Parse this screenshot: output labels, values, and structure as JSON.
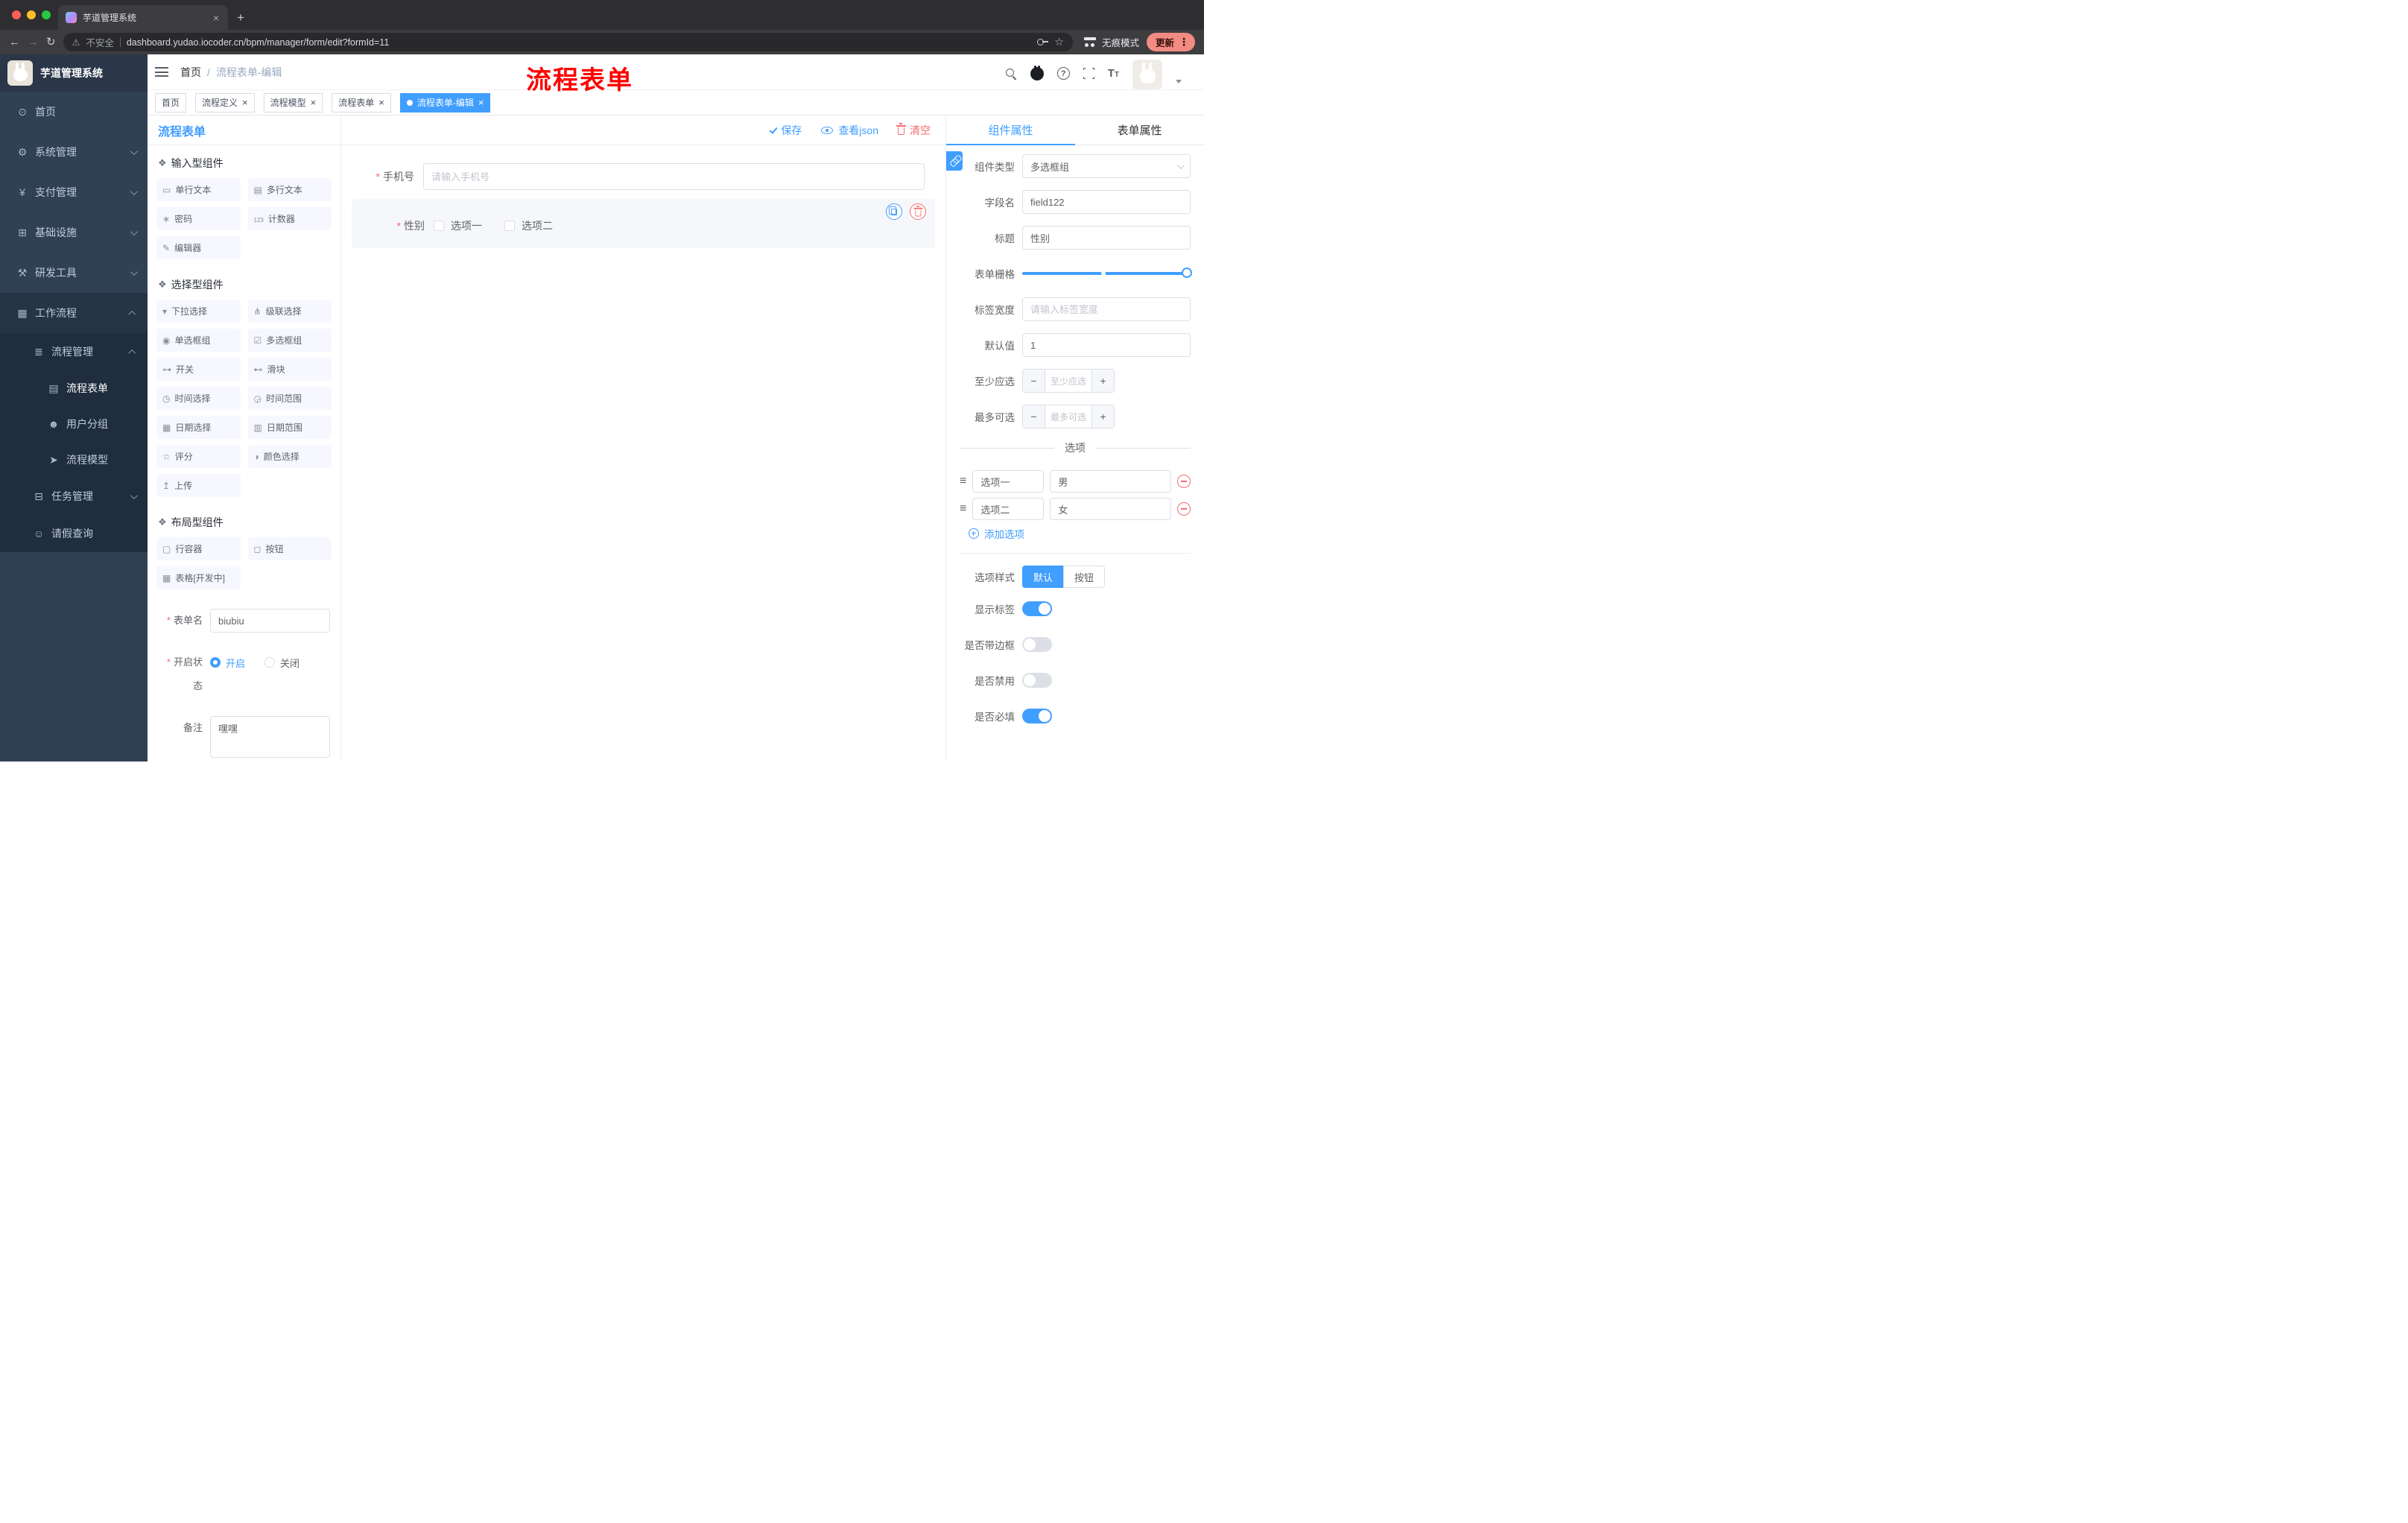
{
  "browser": {
    "tab_title": "芋道管理系统",
    "security_label": "不安全",
    "url": "dashboard.yudao.iocoder.cn/bpm/manager/form/edit?formId=11",
    "incognito_label": "无痕模式",
    "update_label": "更新"
  },
  "annotation": {
    "text": "流程表单"
  },
  "sidebar": {
    "logo_title": "芋道管理系统",
    "items": [
      "首页",
      "系统管理",
      "支付管理",
      "基础设施",
      "研发工具",
      "工作流程",
      "流程管理",
      "流程表单",
      "用户分组",
      "流程模型",
      "任务管理",
      "请假查询"
    ]
  },
  "header": {
    "breadcrumb_home": "首页",
    "breadcrumb_current": "流程表单-编辑"
  },
  "tags": [
    "首页",
    "流程定义",
    "流程模型",
    "流程表单",
    "流程表单-编辑"
  ],
  "palette": {
    "title": "流程表单",
    "sections": [
      {
        "title": "输入型组件",
        "items": [
          "单行文本",
          "多行文本",
          "密码",
          "计数器",
          "编辑器"
        ]
      },
      {
        "title": "选择型组件",
        "items": [
          "下拉选择",
          "级联选择",
          "单选框组",
          "多选框组",
          "开关",
          "滑块",
          "时间选择",
          "时间范围",
          "日期选择",
          "日期范围",
          "评分",
          "颜色选择",
          "上传"
        ]
      },
      {
        "title": "布局型组件",
        "items": [
          "行容器",
          "按钮",
          "表格[开发中]"
        ]
      }
    ],
    "form": {
      "name_label": "表单名",
      "name_value": "biubiu",
      "status_label": "开启状态",
      "status_on": "开启",
      "status_off": "关闭",
      "remark_label": "备注",
      "remark_value": "嘿嘿"
    }
  },
  "canvas": {
    "toolbar": {
      "save": "保存",
      "view_json": "查看json",
      "clear": "清空"
    },
    "phone": {
      "label": "手机号",
      "placeholder": "请输入手机号"
    },
    "gender": {
      "label": "性别",
      "options": [
        "选项一",
        "选项二"
      ]
    }
  },
  "inspector": {
    "tab_component": "组件属性",
    "tab_form": "表单属性",
    "component_type": {
      "label": "组件类型",
      "value": "多选框组"
    },
    "field_name": {
      "label": "字段名",
      "value": "field122"
    },
    "title": {
      "label": "标题",
      "value": "性别"
    },
    "grid": {
      "label": "表单栅格"
    },
    "label_width": {
      "label": "标签宽度",
      "placeholder": "请输入标签宽度"
    },
    "default_value": {
      "label": "默认值",
      "value": "1"
    },
    "min_select": {
      "label": "至少应选",
      "placeholder": "至少应选"
    },
    "max_select": {
      "label": "最多可选",
      "placeholder": "最多可选"
    },
    "options_title": "选项",
    "options": [
      {
        "label": "选项一",
        "value": "男"
      },
      {
        "label": "选项二",
        "value": "女"
      }
    ],
    "add_option": "添加选项",
    "option_style": {
      "label": "选项样式",
      "default": "默认",
      "button": "按钮"
    },
    "switches": [
      {
        "label": "显示标签"
      },
      {
        "label": "是否带边框"
      },
      {
        "label": "是否禁用"
      },
      {
        "label": "是否必填"
      }
    ]
  },
  "colors": {
    "primary": "#409eff",
    "danger": "#f56c6c",
    "annotation_red": "#fe0000"
  }
}
